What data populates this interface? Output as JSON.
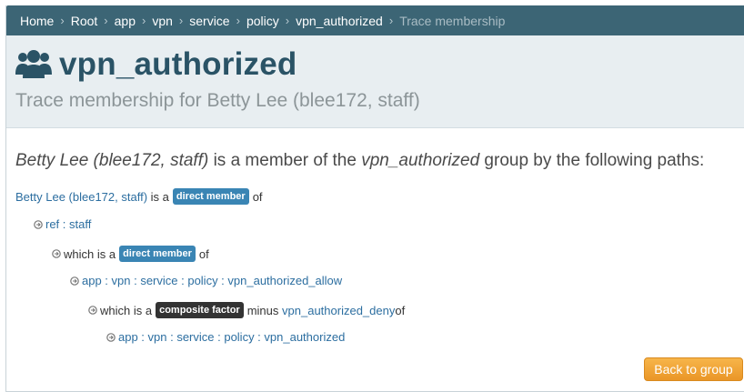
{
  "breadcrumb": {
    "items": [
      "Home",
      "Root",
      "app",
      "vpn",
      "service",
      "policy",
      "vpn_authorized"
    ],
    "current": "Trace membership",
    "separator": "›"
  },
  "header": {
    "icon": "users-icon",
    "title": "vpn_authorized",
    "subtitle": "Trace membership for Betty Lee (blee172, staff)"
  },
  "lead": {
    "subject": "Betty Lee (blee172, staff)",
    "text1": " is a member of the ",
    "group": "vpn_authorized",
    "text2": " group by the following paths:"
  },
  "trace": {
    "row1": {
      "link": "Betty Lee (blee172, staff)",
      "text": " is a ",
      "badge": "direct member",
      "after": "of"
    },
    "row2": {
      "link": "ref : staff"
    },
    "row3": {
      "text": "which is a ",
      "badge": "direct member",
      "after": "of"
    },
    "row4": {
      "link": "app : vpn : service : policy : vpn_authorized_allow"
    },
    "row5": {
      "text": "which is a ",
      "badge": "composite factor",
      "mid": "minus ",
      "link": "vpn_authorized_deny",
      "after": " of"
    },
    "row6": {
      "link": "app : vpn : service : policy : vpn_authorized"
    }
  },
  "actions": {
    "back_label": "Back to group"
  },
  "colors": {
    "breadcrumb_bg": "#3c6575",
    "title": "#2a5366",
    "header_bg": "#e8eef1",
    "link": "#2c6ea0",
    "badge_direct": "#3a85b4",
    "badge_composite": "#333333",
    "button": "#f0a538"
  }
}
